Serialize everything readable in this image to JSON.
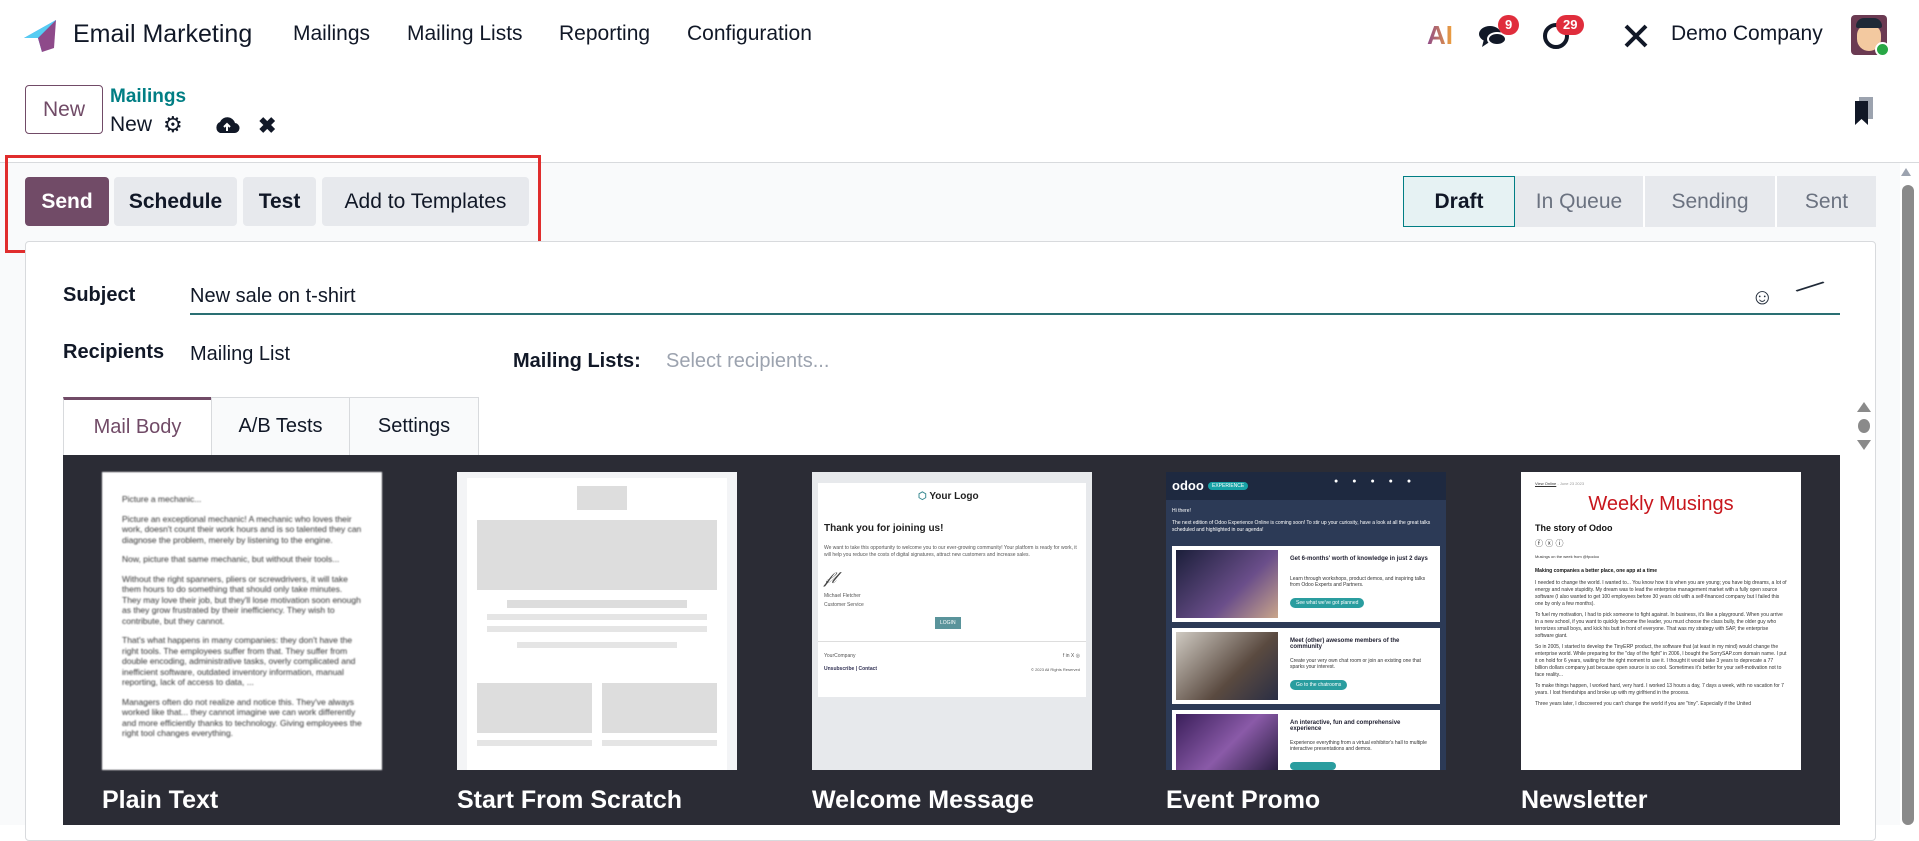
{
  "navbar": {
    "app_title": "Email Marketing",
    "menu": [
      "Mailings",
      "Mailing Lists",
      "Reporting",
      "Configuration"
    ],
    "ai_label": "AI",
    "messages_count": "9",
    "activities_count": "29",
    "company": "Demo Company"
  },
  "control_panel": {
    "new_button": "New",
    "breadcrumb_parent": "Mailings",
    "breadcrumb_current": "New"
  },
  "actions": [
    "Send",
    "Schedule",
    "Test",
    "Add to Templates"
  ],
  "status_steps": [
    "Draft",
    "In Queue",
    "Sending",
    "Sent"
  ],
  "active_status": "Draft",
  "form": {
    "subject_label": "Subject",
    "subject_value": "New sale on t-shirt",
    "recipients_label": "Recipients",
    "recipients_value": "Mailing List",
    "mailing_lists_label": "Mailing Lists:",
    "mailing_lists_placeholder": "Select recipients..."
  },
  "tabs": [
    "Mail Body",
    "A/B Tests",
    "Settings"
  ],
  "active_tab": "Mail Body",
  "templates": {
    "names": [
      "Plain Text",
      "Start From Scratch",
      "Welcome Message",
      "Event Promo",
      "Newsletter"
    ],
    "plain_text": [
      "Picture a mechanic...",
      "Picture an exceptional mechanic! A mechanic who loves their work, doesn't count their work hours and is so talented they can diagnose the problem, merely by listening to the engine.",
      "Now, picture that same mechanic, but without their tools...",
      "Without the right spanners, pliers or screwdrivers, it will take them hours to do something that should only take minutes. They may love their job, but they'll lose motivation soon enough as they grow frustrated by their inefficiency. They wish to contribute, but they cannot.",
      "That's what happens in many companies: they don't have the right tools. The employees suffer from that. They suffer from double encoding, administrative tasks, overly complicated and inefficient software, outdated inventory information, manual reporting, lack of access to data, ...",
      "Managers often do not realize and notice this. They've always worked like that... they cannot imagine we can work differently and more efficiently thanks to technology. Giving employees the right tool changes everything."
    ],
    "welcome": {
      "logo": "Your Logo",
      "heading": "Thank you for joining us!",
      "body": "We want to take this opportunity to welcome you to our ever-growing community! Your platform is ready for work, it will help you reduce the costs of digital signatures, attract new customers and increase sales.",
      "signer": "Michael Fletcher",
      "signer_role": "Customer Service",
      "button": "LOGIN",
      "company": "YourCompany",
      "footer_links": "Unsubscribe | Contact",
      "copyright": "© 2023 All Rights Reserved"
    },
    "event": {
      "brand": "odoo",
      "tag": "EXPERIENCE",
      "greeting": "Hi there!",
      "intro": "The next edition of Odoo Experience Online is coming soon! To stir up your curiosity, have a look at all the great talks scheduled and highlighted in our agenda!",
      "cards": [
        {
          "title": "Get 6-months' worth of knowledge in just 2 days",
          "text": "Learn through workshops, product demos, and inspiring talks from Odoo Experts and Partners.",
          "button": "See what we've got planned"
        },
        {
          "title": "Meet (other) awesome members of the community",
          "text": "Create your very own chat room or join an existing one that sparks your interest.",
          "button": "Go to the chatrooms"
        },
        {
          "title": "An interactive, fun and comprehensive experience",
          "text": "Experience everything from a virtual exhibitor's hall to multiple interactive presentations and demos.",
          "button": ""
        }
      ]
    },
    "newsletter": {
      "view_online": "View Online",
      "date": "- June 23 2023",
      "title": "Weekly Musings",
      "subtitle": "The story of Odoo",
      "byline": "Musings on the week from @fpodoo",
      "section": "Making companies a better place, one app at a time",
      "paragraphs": [
        "I needed to change the world. I wanted to... You know how it is when you are young; you have big dreams, a lot of energy and naive stupidity. My dream was to lead the enterprise management market with a fully open source software (I also wanted to get 100 employees before 30 years old with a self-financed company but I failed this one by only a few months).",
        "To fuel my motivation, I had to pick someone to fight against. In business, it's like a playground. When you arrive in a new school, if you want to quickly become the leader, you must choose the class bully, the older guy who terrorizes small boys, and kick his butt in front of everyone. That was my strategy with SAP, the enterprise software giant.",
        "So in 2005, I started to develop the TinyERP product, the software that (at least in my mind) would change the enterprise world. While preparing for the \"day of the fight\" in 2006, I bought the SorrySAP.com domain name. I put it on hold for 6 years, waiting for the right moment to use it. I thought it would take 3 years to deprecate a 77 billion dollars company just because open source is so cool. Sometimes it's better for your self-motivation not to face reality...",
        "To make things happen, I worked hard, very hard. I worked 13 hours a day, 7 days a week, with no vacation for 7 years. I lost friendships and broke up with my girlfriend in the process.",
        "Three years later, I discovered you can't change the world if you are \"tiny\". Especially if the United"
      ]
    }
  },
  "colors": {
    "brand": "#714b67",
    "teal": "#017e84",
    "badge": "#e02d3c",
    "dark_bg": "#2b2c35"
  }
}
